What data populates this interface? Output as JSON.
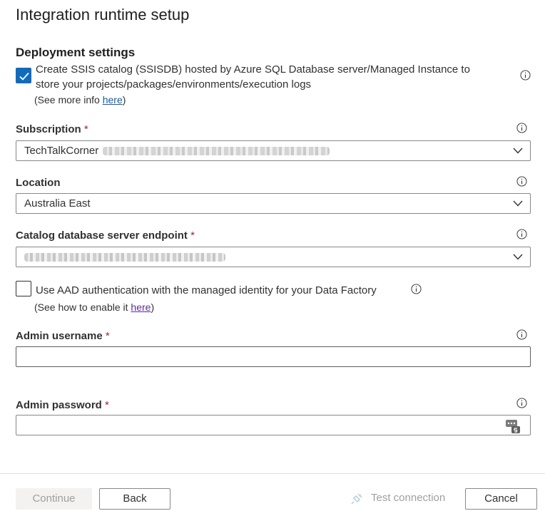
{
  "title": "Integration runtime setup",
  "section_title": "Deployment settings",
  "ssis_catalog": {
    "checked": true,
    "label_line1": "Create SSIS catalog (SSISDB) hosted by Azure SQL Database server/Managed Instance to",
    "label_line2": "store your projects/packages/environments/execution logs",
    "more_prefix": "(See more info ",
    "more_link": "here",
    "more_suffix": ")"
  },
  "subscription": {
    "label": "Subscription",
    "required_mark": "*",
    "value": "TechTalkCorner"
  },
  "location": {
    "label": "Location",
    "value": "Australia East"
  },
  "catalog_endpoint": {
    "label": "Catalog database server endpoint",
    "required_mark": "*"
  },
  "aad": {
    "checked": false,
    "label": "Use AAD authentication with the managed identity for your Data Factory",
    "help_prefix": "(See how to enable it ",
    "help_link": "here",
    "help_suffix": ")"
  },
  "admin_username": {
    "label": "Admin username",
    "required_mark": "*",
    "value": ""
  },
  "admin_password": {
    "label": "Admin password",
    "required_mark": "*",
    "value": ""
  },
  "footer": {
    "continue_label": "Continue",
    "back_label": "Back",
    "test_label": "Test connection",
    "cancel_label": "Cancel"
  },
  "colors": {
    "accent": "#0f6cbd",
    "required": "#a4262c",
    "link": "#0f5fa8",
    "disabled_text": "#a19f9d"
  },
  "icons": [
    "info-icon",
    "chevron-down-icon",
    "checkmark-icon",
    "password-manager-icon",
    "plug-icon"
  ]
}
